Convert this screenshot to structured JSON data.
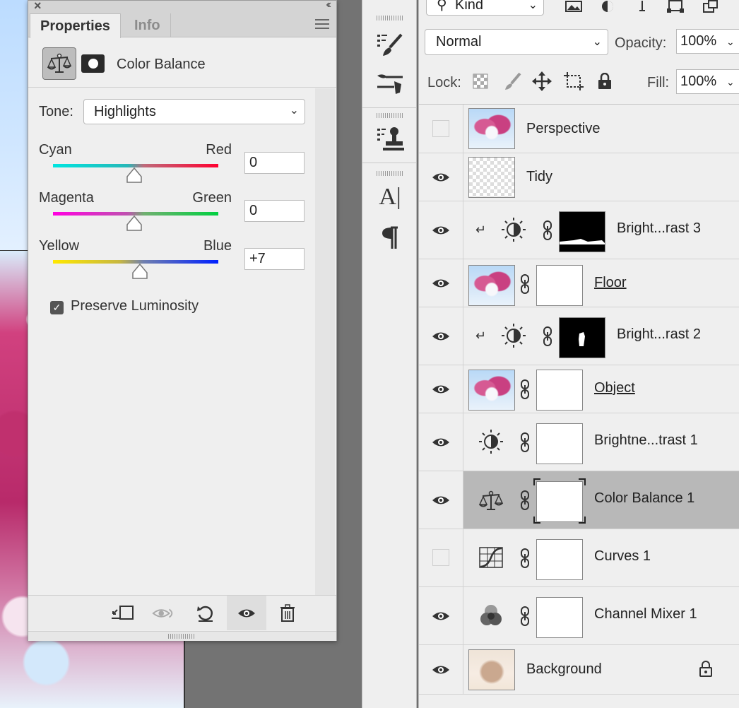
{
  "properties": {
    "tabs": [
      "Properties",
      "Info"
    ],
    "adjustment_title": "Color Balance",
    "tone_label": "Tone:",
    "tone_value": "Highlights",
    "sliders": [
      {
        "left": "Cyan",
        "right": "Red",
        "value": "0"
      },
      {
        "left": "Magenta",
        "right": "Green",
        "value": "0"
      },
      {
        "left": "Yellow",
        "right": "Blue",
        "value": "+7"
      }
    ],
    "preserve_luminosity": "Preserve Luminosity"
  },
  "layers_panel": {
    "kind_filter": "Kind",
    "blend_mode": "Normal",
    "opacity_label": "Opacity:",
    "opacity_value": "100%",
    "lock_label": "Lock:",
    "fill_label": "Fill:",
    "fill_value": "100%",
    "layers": [
      {
        "name": "Perspective",
        "visible": false,
        "type": "pixel"
      },
      {
        "name": "Tidy",
        "visible": true,
        "type": "transparent"
      },
      {
        "name": "Bright...rast 3",
        "visible": true,
        "type": "brightness-contrast",
        "clipped": true
      },
      {
        "name": "Floor",
        "visible": true,
        "type": "pixel-masked"
      },
      {
        "name": "Bright...rast 2",
        "visible": true,
        "type": "brightness-contrast",
        "clipped": true
      },
      {
        "name": "Object",
        "visible": true,
        "type": "pixel-masked"
      },
      {
        "name": "Brightne...trast 1",
        "visible": true,
        "type": "brightness-contrast"
      },
      {
        "name": "Color Balance 1",
        "visible": true,
        "type": "color-balance",
        "selected": true
      },
      {
        "name": "Curves 1",
        "visible": false,
        "type": "curves"
      },
      {
        "name": "Channel Mixer 1",
        "visible": true,
        "type": "channel-mixer"
      },
      {
        "name": "Background",
        "visible": true,
        "type": "background",
        "locked": true
      }
    ]
  },
  "colors": {
    "panel_bg": "#efefef",
    "selected_layer": "#b8b8b8",
    "accent_cyan_red": [
      "#00e5e0",
      "#ff0030"
    ],
    "accent_magenta_green": [
      "#ff00e0",
      "#00d040"
    ],
    "accent_yellow_blue": [
      "#ffe800",
      "#0020ff"
    ]
  }
}
